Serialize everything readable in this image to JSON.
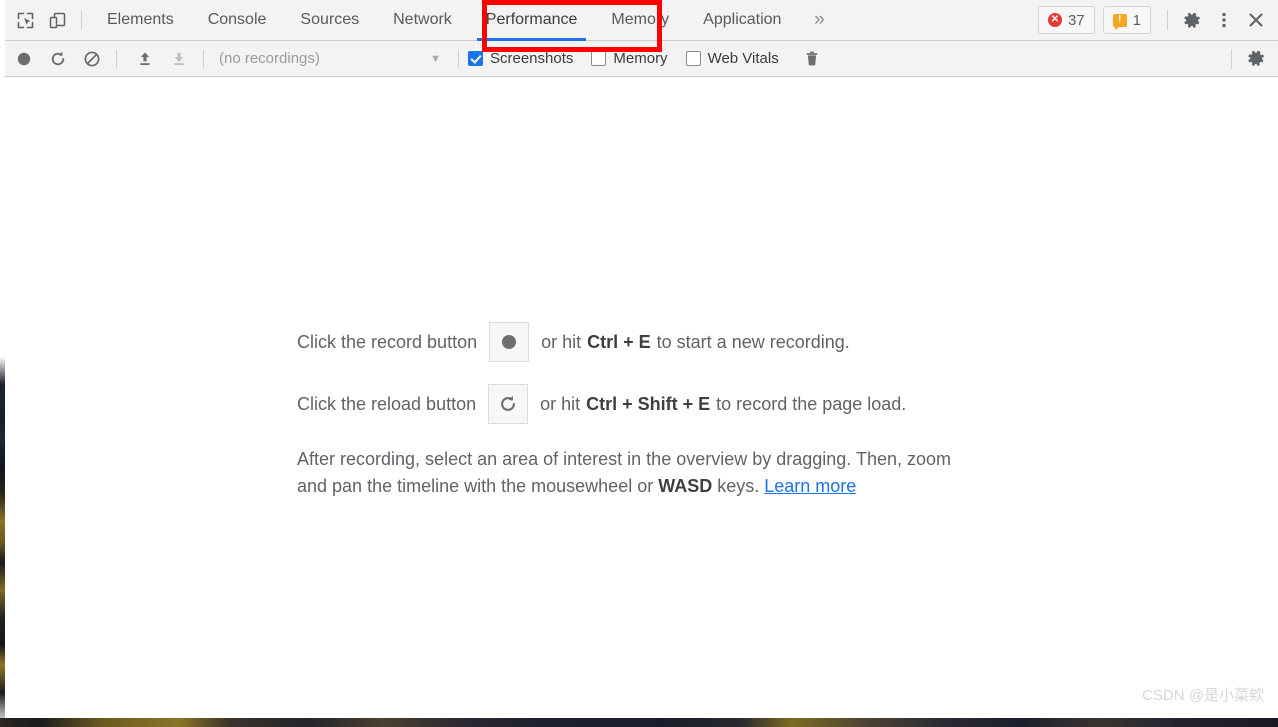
{
  "window": {
    "title": "Chrome DevTools — Performance panel"
  },
  "tabbar": {
    "inspect_icon": "inspect-element-icon",
    "device_icon": "device-toolbar-icon",
    "tabs": [
      {
        "label": "Elements",
        "active": false
      },
      {
        "label": "Console",
        "active": false
      },
      {
        "label": "Sources",
        "active": false
      },
      {
        "label": "Network",
        "active": false
      },
      {
        "label": "Performance",
        "active": true
      },
      {
        "label": "Memory",
        "active": false
      },
      {
        "label": "Application",
        "active": false
      }
    ],
    "overflow_label": "»",
    "error_badge": {
      "count": "37",
      "icon": "error-circle-icon",
      "color": "#e53935"
    },
    "warning_badge": {
      "count": "1",
      "icon": "warning-bubble-icon",
      "color": "#f5a623"
    },
    "settings_icon": "gear-icon",
    "more_icon": "kebab-menu-icon",
    "close_icon": "close-icon",
    "active_tab_underline_color": "#1a73e8"
  },
  "perfbar": {
    "record_icon": "record-circle-icon",
    "reload_icon": "reload-icon",
    "clear_icon": "clear-no-entry-icon",
    "upload_icon": "upload-profile-icon",
    "download_icon": "download-profile-icon",
    "recordings_value": "(no recordings)",
    "recordings_caret": "▼",
    "checkboxes": [
      {
        "label": "Screenshots",
        "checked": true
      },
      {
        "label": "Memory",
        "checked": false
      },
      {
        "label": "Web Vitals",
        "checked": false
      }
    ],
    "trash_icon": "trash-icon",
    "settings_icon": "gear-icon"
  },
  "panel": {
    "record_line": {
      "before": "Click the record button",
      "button_icon": "record-circle-icon",
      "middle": "or hit",
      "shortcut": "Ctrl + E",
      "after": "to start a new recording."
    },
    "reload_line": {
      "before": "Click the reload button",
      "button_icon": "reload-icon",
      "middle": "or hit",
      "shortcut": "Ctrl + Shift + E",
      "after": "to record the page load."
    },
    "hint_paragraph": {
      "part1": "After recording, select an area of interest in the overview by dragging. Then, zoom and pan the timeline with the mousewheel or ",
      "emphasis": "WASD",
      "part2": " keys. ",
      "link": "Learn more"
    }
  },
  "annotation": {
    "highlight_target": "Performance",
    "highlight_color": "#ff0000"
  },
  "watermark": {
    "text": "CSDN @是小菜欸"
  }
}
